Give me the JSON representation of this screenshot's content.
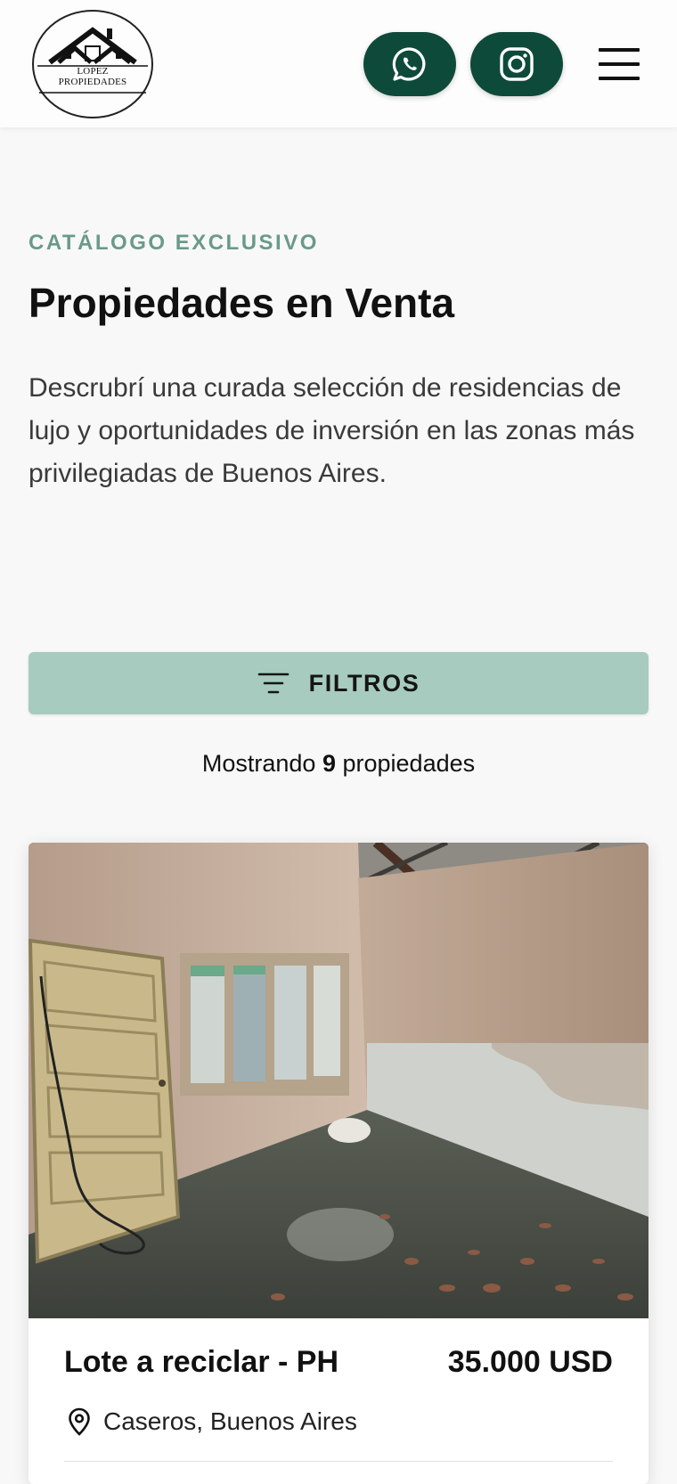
{
  "header": {
    "logo": {
      "line1": "LOPEZ",
      "line2": "PROPIEDADES"
    },
    "whatsapp_icon": "whatsapp-icon",
    "instagram_icon": "instagram-icon",
    "menu_icon": "hamburger-menu-icon"
  },
  "hero": {
    "eyebrow": "CATÁLOGO EXCLUSIVO",
    "title": "Propiedades en Venta",
    "description": "Descrubrí una curada selección de residencias de lujo y oportunidades de inversión en las zonas más privilegiadas de Buenos Aires."
  },
  "filters": {
    "label": "FILTROS",
    "icon": "filter-lines-icon"
  },
  "results": {
    "prefix": "Mostrando",
    "count": "9",
    "suffix": "propiedades"
  },
  "listings": [
    {
      "title": "Lote a reciclar - PH",
      "price": "35.000 USD",
      "location": "Caseros, Buenos Aires",
      "image": "interior-room-photo"
    }
  ],
  "colors": {
    "brand_green": "#0e4a39",
    "accent_light": "#a7cbbf",
    "eyebrow": "#6a9a88",
    "background": "#f8f8f8"
  }
}
